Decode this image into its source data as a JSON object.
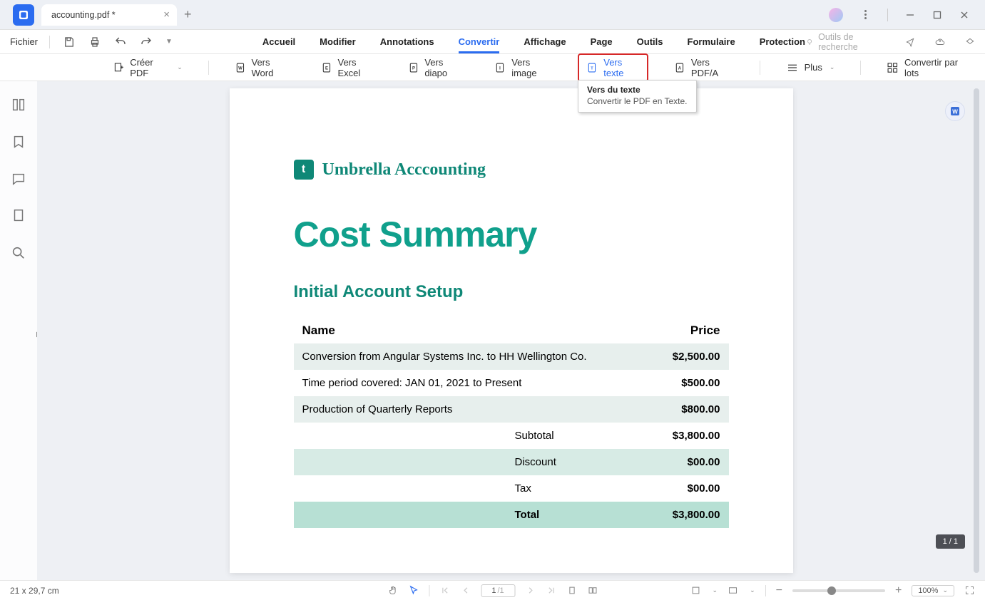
{
  "titlebar": {
    "tab_name": "accounting.pdf *"
  },
  "menubar": {
    "file_label": "Fichier",
    "items": [
      "Accueil",
      "Modifier",
      "Annotations",
      "Convertir",
      "Affichage",
      "Page",
      "Outils",
      "Formulaire",
      "Protection"
    ],
    "active_index": 3,
    "search_label": "Outils de recherche"
  },
  "ribbon": {
    "create_pdf": "Créer PDF",
    "btns": [
      {
        "label": "Vers Word",
        "icon": "W"
      },
      {
        "label": "Vers Excel",
        "icon": "E"
      },
      {
        "label": "Vers diapo",
        "icon": "P"
      },
      {
        "label": "Vers image",
        "icon": "I"
      },
      {
        "label": "Vers texte",
        "icon": "T",
        "active": true
      },
      {
        "label": "Vers PDF/A",
        "icon": "A"
      }
    ],
    "more_label": "Plus",
    "batch_label": "Convertir par lots"
  },
  "tooltip": {
    "title": "Vers du texte",
    "body": "Convertir le PDF en Texte."
  },
  "document": {
    "brand": "Umbrella Acccounting",
    "title": "Cost Summary",
    "subtitle": "Initial Account Setup",
    "headers": {
      "name": "Name",
      "price": "Price"
    },
    "rows": [
      {
        "name": "Conversion from Angular Systems Inc. to HH Wellington Co.",
        "price": "$2,500.00"
      },
      {
        "name": "Time period covered: JAN 01, 2021 to Present",
        "price": "$500.00"
      },
      {
        "name": "Production of Quarterly Reports",
        "price": "$800.00"
      }
    ],
    "summary": [
      {
        "label": "Subtotal",
        "value": "$3,800.00",
        "cls": ""
      },
      {
        "label": "Discount",
        "value": "$00.00",
        "cls": "alt"
      },
      {
        "label": "Tax",
        "value": "$00.00",
        "cls": ""
      },
      {
        "label": "Total",
        "value": "$3,800.00",
        "cls": "total"
      }
    ]
  },
  "page_badge": "1 / 1",
  "statusbar": {
    "dims": "21 x 29,7 cm",
    "page_current": "1",
    "page_total": "/1",
    "zoom": "100%"
  }
}
